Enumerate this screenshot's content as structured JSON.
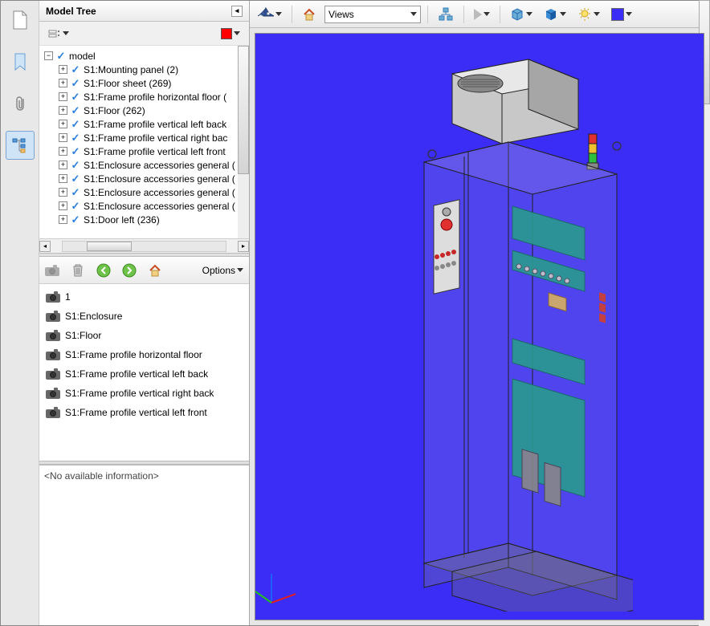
{
  "panel": {
    "title": "Model Tree"
  },
  "tree": {
    "root_label": "model",
    "items": [
      "S1:Mounting panel (2)",
      "S1:Floor sheet (269)",
      "S1:Frame profile horizontal floor (",
      "S1:Floor (262)",
      "S1:Frame profile vertical left back",
      "S1:Frame profile vertical right bac",
      "S1:Frame profile vertical left front",
      "S1:Enclosure accessories general (",
      "S1:Enclosure accessories general (",
      "S1:Enclosure accessories general (",
      "S1:Enclosure accessories general (",
      "S1:Door left (236)"
    ]
  },
  "list_toolbar": {
    "options_label": "Options"
  },
  "list_items": [
    "1",
    "S1:Enclosure",
    "S1:Floor",
    "S1:Frame profile horizontal floor",
    "S1:Frame profile vertical left back",
    "S1:Frame profile vertical right back",
    "S1:Frame profile vertical left front"
  ],
  "info_panel": {
    "no_info_text": "<No available information>"
  },
  "viewport_toolbar": {
    "views_label": "Views"
  }
}
